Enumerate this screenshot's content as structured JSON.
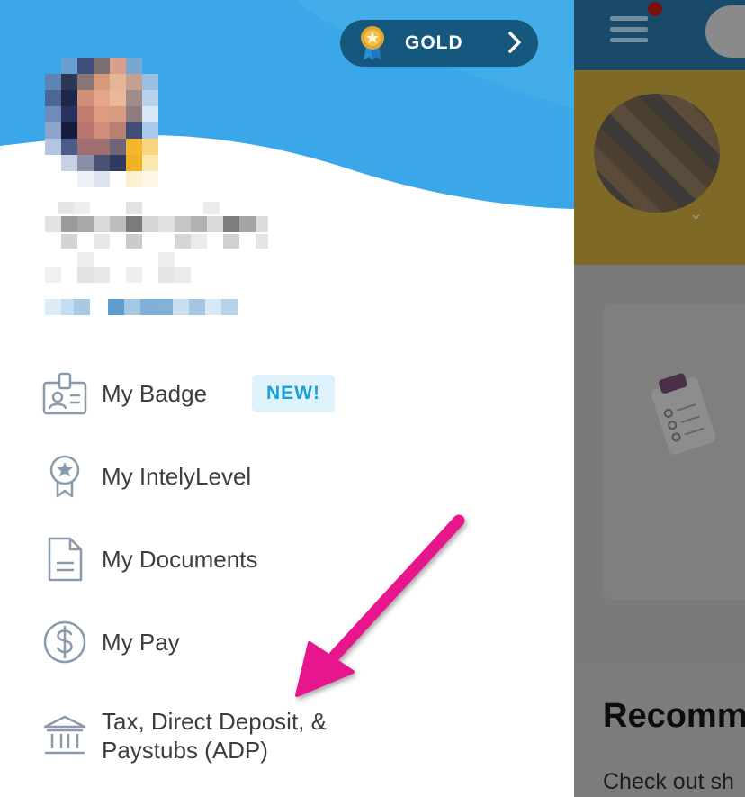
{
  "colors": {
    "header_blue": "#3aa8e8",
    "gold_pill": "#16577e",
    "menu_text": "#3d3d3d",
    "icon_gray": "#8a9aaa",
    "badge_bg": "#dff1fb",
    "badge_text": "#1aa1dc",
    "annotation_pink": "#e8188d"
  },
  "level_badge": {
    "label": "GOLD",
    "icon": "gold-medal-icon",
    "chevron": "chevron-right-icon"
  },
  "profile": {
    "avatar": "pixelated-avatar"
  },
  "menu": [
    {
      "label": "My Badge",
      "icon": "id-badge-icon",
      "badge": "NEW!"
    },
    {
      "label": "My IntelyLevel",
      "icon": "star-ribbon-icon"
    },
    {
      "label": "My Documents",
      "icon": "document-icon"
    },
    {
      "label": "My Pay",
      "icon": "dollar-circle-icon"
    },
    {
      "label": "Tax, Direct Deposit, & Paystubs (ADP)",
      "label_line1": "Tax, Direct Deposit, &",
      "label_line2": "Paystubs (ADP)",
      "icon": "bank-icon"
    }
  ],
  "background_app": {
    "heading": "Recomm",
    "subtext": "Check out sh"
  }
}
